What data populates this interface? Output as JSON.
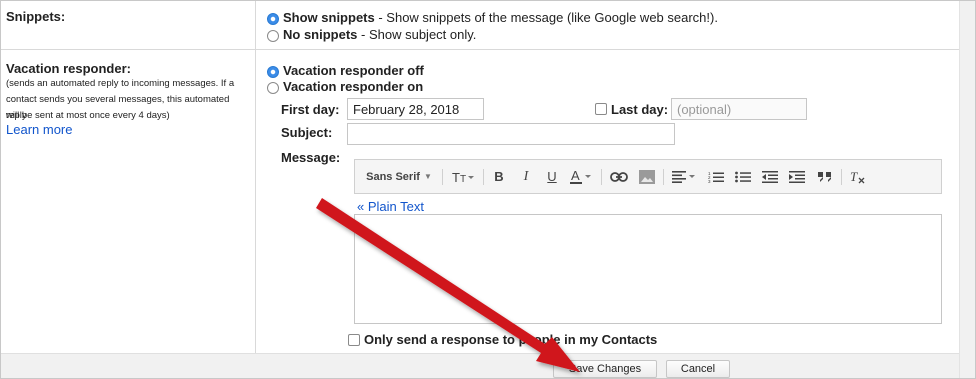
{
  "snippets": {
    "label": "Snippets:",
    "show": {
      "title": "Show snippets",
      "desc": " - Show snippets of the message (like Google web search!).",
      "selected": true
    },
    "none": {
      "title": "No snippets",
      "desc": " - Show subject only.",
      "selected": false
    }
  },
  "vacation": {
    "label": "Vacation responder:",
    "note_lines": [
      "(sends an automated reply to incoming messages. If a",
      "contact sends you several messages, this automated reply",
      "will be sent at most once every 4 days)"
    ],
    "learn_more": "Learn more",
    "off_label": "Vacation responder off",
    "on_label": "Vacation responder on",
    "off_selected": true,
    "first_day_label": "First day:",
    "first_day_value": "February 28, 2018",
    "last_day_label": "Last day:",
    "last_day_placeholder": "(optional)",
    "last_day_checked": false,
    "subject_label": "Subject:",
    "subject_value": "",
    "message_label": "Message:",
    "plain_text_link": "« Plain Text",
    "contacts_only_label": "Only send a response to people in my Contacts",
    "contacts_only_checked": false
  },
  "toolbar": {
    "font_label": "Sans Serif",
    "icons": [
      "text-size-icon",
      "bold-icon",
      "italic-icon",
      "underline-icon",
      "text-color-icon",
      "link-icon",
      "image-icon",
      "align-icon",
      "numbered-list-icon",
      "bulleted-list-icon",
      "indent-less-icon",
      "indent-more-icon",
      "quote-icon",
      "remove-formatting-icon"
    ]
  },
  "footer": {
    "save_label": "Save Changes",
    "cancel_label": "Cancel"
  },
  "annotation": {
    "arrow_color": "#d0141c"
  }
}
